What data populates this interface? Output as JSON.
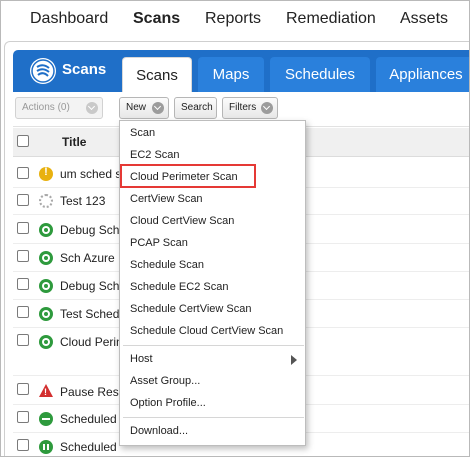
{
  "topnav": {
    "items": [
      {
        "label": "Dashboard",
        "active": false
      },
      {
        "label": "Scans",
        "active": true
      },
      {
        "label": "Reports",
        "active": false
      },
      {
        "label": "Remediation",
        "active": false
      },
      {
        "label": "Assets",
        "active": false
      }
    ]
  },
  "module": {
    "brand": "Scans",
    "logo_icon": "qualys-scans-logo",
    "accent": "#1f6fc8",
    "tabs": [
      {
        "label": "Scans",
        "active": true
      },
      {
        "label": "Maps",
        "active": false
      },
      {
        "label": "Schedules",
        "active": false
      },
      {
        "label": "Appliances",
        "active": false
      }
    ]
  },
  "toolbar": {
    "actions_label": "Actions (0)",
    "new_label": "New",
    "search_label": "Search",
    "filters_label": "Filters"
  },
  "table": {
    "title_header": "Title",
    "rows": [
      {
        "status": "warning",
        "title": "um sched s"
      },
      {
        "status": "loading",
        "title": "Test 123"
      },
      {
        "status": "running",
        "title": "Debug Sch"
      },
      {
        "status": "running",
        "title": "Sch Azure"
      },
      {
        "status": "running",
        "title": "Debug Sch"
      },
      {
        "status": "running",
        "title": "Test Sched"
      },
      {
        "status": "running",
        "title": "Cloud Perin"
      },
      {
        "status": "error",
        "title": "Pause Res"
      },
      {
        "status": "blocked",
        "title": "Scheduled"
      },
      {
        "status": "paused",
        "title": "Scheduled"
      }
    ]
  },
  "new_menu": {
    "items": [
      {
        "label": "Scan"
      },
      {
        "label": "EC2 Scan"
      },
      {
        "label": "Cloud Perimeter Scan",
        "highlighted": true
      },
      {
        "label": "CertView Scan"
      },
      {
        "label": "Cloud CertView Scan"
      },
      {
        "label": "PCAP Scan"
      },
      {
        "label": "Schedule Scan"
      },
      {
        "label": "Schedule EC2 Scan"
      },
      {
        "label": "Schedule CertView Scan"
      },
      {
        "label": "Schedule Cloud CertView Scan"
      }
    ],
    "group2": [
      {
        "label": "Host",
        "submenu": true
      },
      {
        "label": "Asset Group..."
      },
      {
        "label": "Option Profile..."
      }
    ],
    "group3": [
      {
        "label": "Download..."
      }
    ],
    "highlight_color": "#e53935"
  }
}
